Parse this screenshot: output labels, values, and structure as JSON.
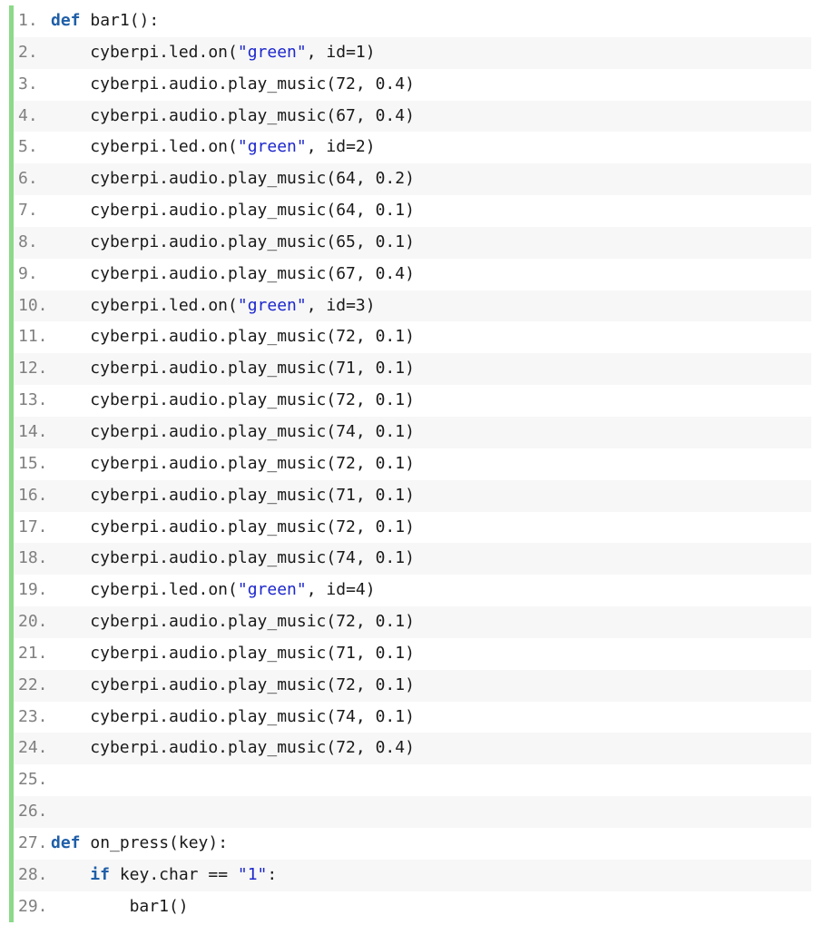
{
  "editor": {
    "colors": {
      "gutter_bar": "#8cd98a",
      "alt_row": "#f7f7f7",
      "keyword": "#1f5fa8",
      "string": "#1d27cc",
      "line_number": "#808080"
    },
    "lines": [
      {
        "num": "1.",
        "indent": 0,
        "tokens": [
          {
            "t": "kw",
            "v": "def"
          },
          {
            "t": "txt",
            "v": " bar1():"
          }
        ]
      },
      {
        "num": "2.",
        "indent": 1,
        "tokens": [
          {
            "t": "txt",
            "v": "cyberpi.led.on("
          },
          {
            "t": "str",
            "v": "\"green\""
          },
          {
            "t": "txt",
            "v": ", id=1)"
          }
        ]
      },
      {
        "num": "3.",
        "indent": 1,
        "tokens": [
          {
            "t": "txt",
            "v": "cyberpi.audio.play_music(72, 0.4)"
          }
        ]
      },
      {
        "num": "4.",
        "indent": 1,
        "tokens": [
          {
            "t": "txt",
            "v": "cyberpi.audio.play_music(67, 0.4)"
          }
        ]
      },
      {
        "num": "5.",
        "indent": 1,
        "tokens": [
          {
            "t": "txt",
            "v": "cyberpi.led.on("
          },
          {
            "t": "str",
            "v": "\"green\""
          },
          {
            "t": "txt",
            "v": ", id=2)"
          }
        ]
      },
      {
        "num": "6.",
        "indent": 1,
        "tokens": [
          {
            "t": "txt",
            "v": "cyberpi.audio.play_music(64, 0.2)"
          }
        ]
      },
      {
        "num": "7.",
        "indent": 1,
        "tokens": [
          {
            "t": "txt",
            "v": "cyberpi.audio.play_music(64, 0.1)"
          }
        ]
      },
      {
        "num": "8.",
        "indent": 1,
        "tokens": [
          {
            "t": "txt",
            "v": "cyberpi.audio.play_music(65, 0.1)"
          }
        ]
      },
      {
        "num": "9.",
        "indent": 1,
        "tokens": [
          {
            "t": "txt",
            "v": "cyberpi.audio.play_music(67, 0.4)"
          }
        ]
      },
      {
        "num": "10.",
        "indent": 1,
        "tokens": [
          {
            "t": "txt",
            "v": "cyberpi.led.on("
          },
          {
            "t": "str",
            "v": "\"green\""
          },
          {
            "t": "txt",
            "v": ", id=3)"
          }
        ]
      },
      {
        "num": "11.",
        "indent": 1,
        "tokens": [
          {
            "t": "txt",
            "v": "cyberpi.audio.play_music(72, 0.1)"
          }
        ]
      },
      {
        "num": "12.",
        "indent": 1,
        "tokens": [
          {
            "t": "txt",
            "v": "cyberpi.audio.play_music(71, 0.1)"
          }
        ]
      },
      {
        "num": "13.",
        "indent": 1,
        "tokens": [
          {
            "t": "txt",
            "v": "cyberpi.audio.play_music(72, 0.1)"
          }
        ]
      },
      {
        "num": "14.",
        "indent": 1,
        "tokens": [
          {
            "t": "txt",
            "v": "cyberpi.audio.play_music(74, 0.1)"
          }
        ]
      },
      {
        "num": "15.",
        "indent": 1,
        "tokens": [
          {
            "t": "txt",
            "v": "cyberpi.audio.play_music(72, 0.1)"
          }
        ]
      },
      {
        "num": "16.",
        "indent": 1,
        "tokens": [
          {
            "t": "txt",
            "v": "cyberpi.audio.play_music(71, 0.1)"
          }
        ]
      },
      {
        "num": "17.",
        "indent": 1,
        "tokens": [
          {
            "t": "txt",
            "v": "cyberpi.audio.play_music(72, 0.1)"
          }
        ]
      },
      {
        "num": "18.",
        "indent": 1,
        "tokens": [
          {
            "t": "txt",
            "v": "cyberpi.audio.play_music(74, 0.1)"
          }
        ]
      },
      {
        "num": "19.",
        "indent": 1,
        "tokens": [
          {
            "t": "txt",
            "v": "cyberpi.led.on("
          },
          {
            "t": "str",
            "v": "\"green\""
          },
          {
            "t": "txt",
            "v": ", id=4)"
          }
        ]
      },
      {
        "num": "20.",
        "indent": 1,
        "tokens": [
          {
            "t": "txt",
            "v": "cyberpi.audio.play_music(72, 0.1)"
          }
        ]
      },
      {
        "num": "21.",
        "indent": 1,
        "tokens": [
          {
            "t": "txt",
            "v": "cyberpi.audio.play_music(71, 0.1)"
          }
        ]
      },
      {
        "num": "22.",
        "indent": 1,
        "tokens": [
          {
            "t": "txt",
            "v": "cyberpi.audio.play_music(72, 0.1)"
          }
        ]
      },
      {
        "num": "23.",
        "indent": 1,
        "tokens": [
          {
            "t": "txt",
            "v": "cyberpi.audio.play_music(74, 0.1)"
          }
        ]
      },
      {
        "num": "24.",
        "indent": 1,
        "tokens": [
          {
            "t": "txt",
            "v": "cyberpi.audio.play_music(72, 0.4)"
          }
        ]
      },
      {
        "num": "25.",
        "indent": 0,
        "tokens": []
      },
      {
        "num": "26.",
        "indent": 0,
        "tokens": []
      },
      {
        "num": "27.",
        "indent": 0,
        "tokens": [
          {
            "t": "kw",
            "v": "def"
          },
          {
            "t": "txt",
            "v": " on_press(key):"
          }
        ]
      },
      {
        "num": "28.",
        "indent": 1,
        "tokens": [
          {
            "t": "kw",
            "v": "if"
          },
          {
            "t": "txt",
            "v": " key.char == "
          },
          {
            "t": "str",
            "v": "\"1\""
          },
          {
            "t": "txt",
            "v": ":"
          }
        ]
      },
      {
        "num": "29.",
        "indent": 2,
        "tokens": [
          {
            "t": "txt",
            "v": "bar1()"
          }
        ]
      }
    ]
  }
}
